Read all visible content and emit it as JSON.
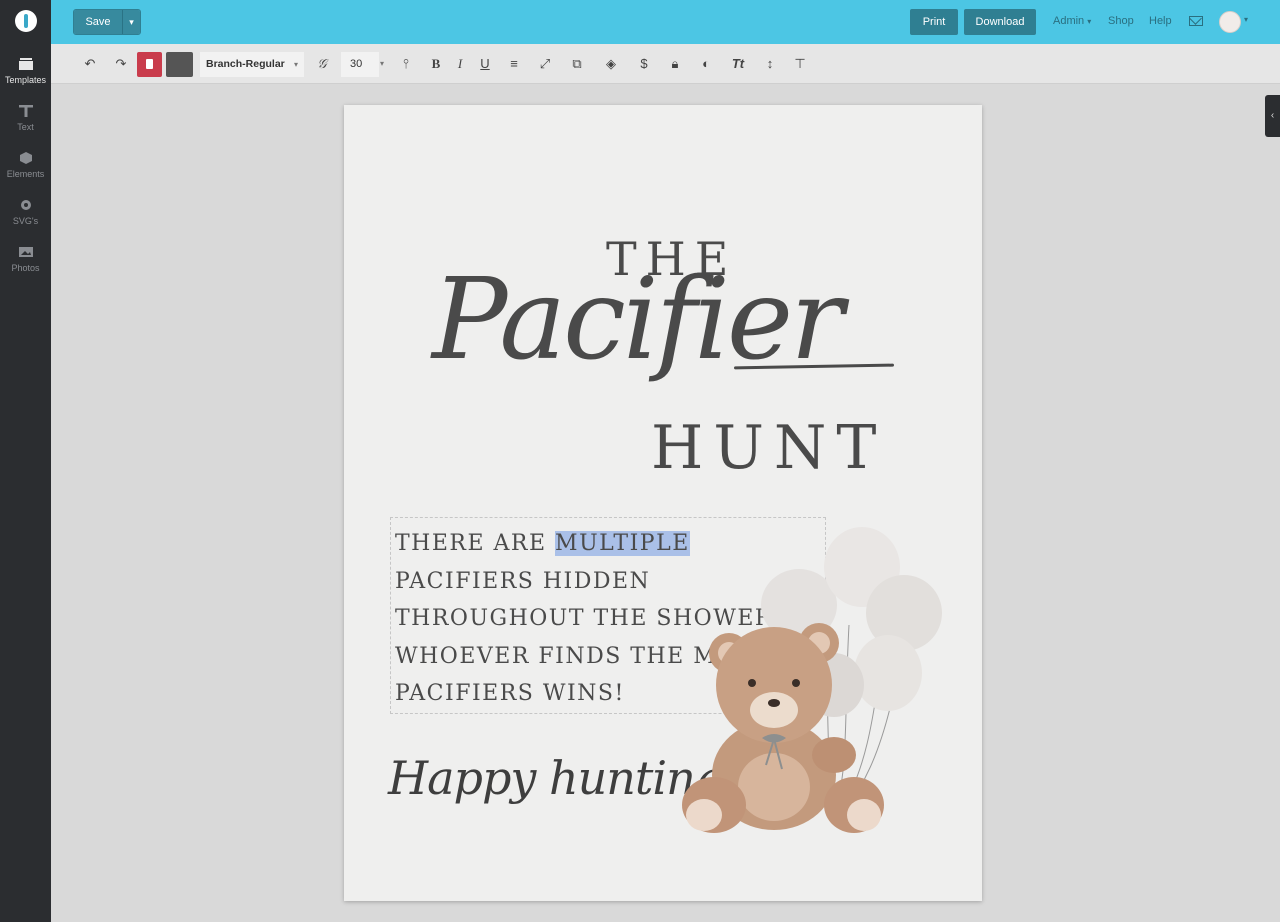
{
  "app": {
    "logo_icon": "app-logo-icon"
  },
  "sidebar": {
    "items": [
      {
        "label": "Templates",
        "icon": "templates-icon"
      },
      {
        "label": "Text",
        "icon": "text-icon"
      },
      {
        "label": "Elements",
        "icon": "elements-icon"
      },
      {
        "label": "SVG's",
        "icon": "gear-icon"
      },
      {
        "label": "Photos",
        "icon": "photos-icon"
      }
    ]
  },
  "topbar": {
    "save_label": "Save",
    "print_label": "Print",
    "download_label": "Download",
    "admin_label": "Admin",
    "shop_label": "Shop",
    "help_label": "Help",
    "accent_color": "#4cc6e4"
  },
  "toolbar": {
    "font_family": "Branch-Regular",
    "font_size": "30",
    "text_color": "#555555",
    "delete_color": "#c93c4c"
  },
  "canvas": {
    "title_top": "THE",
    "title_script": "Pacifier",
    "title_bottom": "HUNT",
    "body_before": "THERE ARE ",
    "body_selected": "MULTIPLE",
    "body_after": " PACIFIERS HIDDEN THROUGHOUT THE SHOWER. WHOEVER FINDS THE MOST PACIFIERS WINS!",
    "closing": "Happy hunting!"
  }
}
